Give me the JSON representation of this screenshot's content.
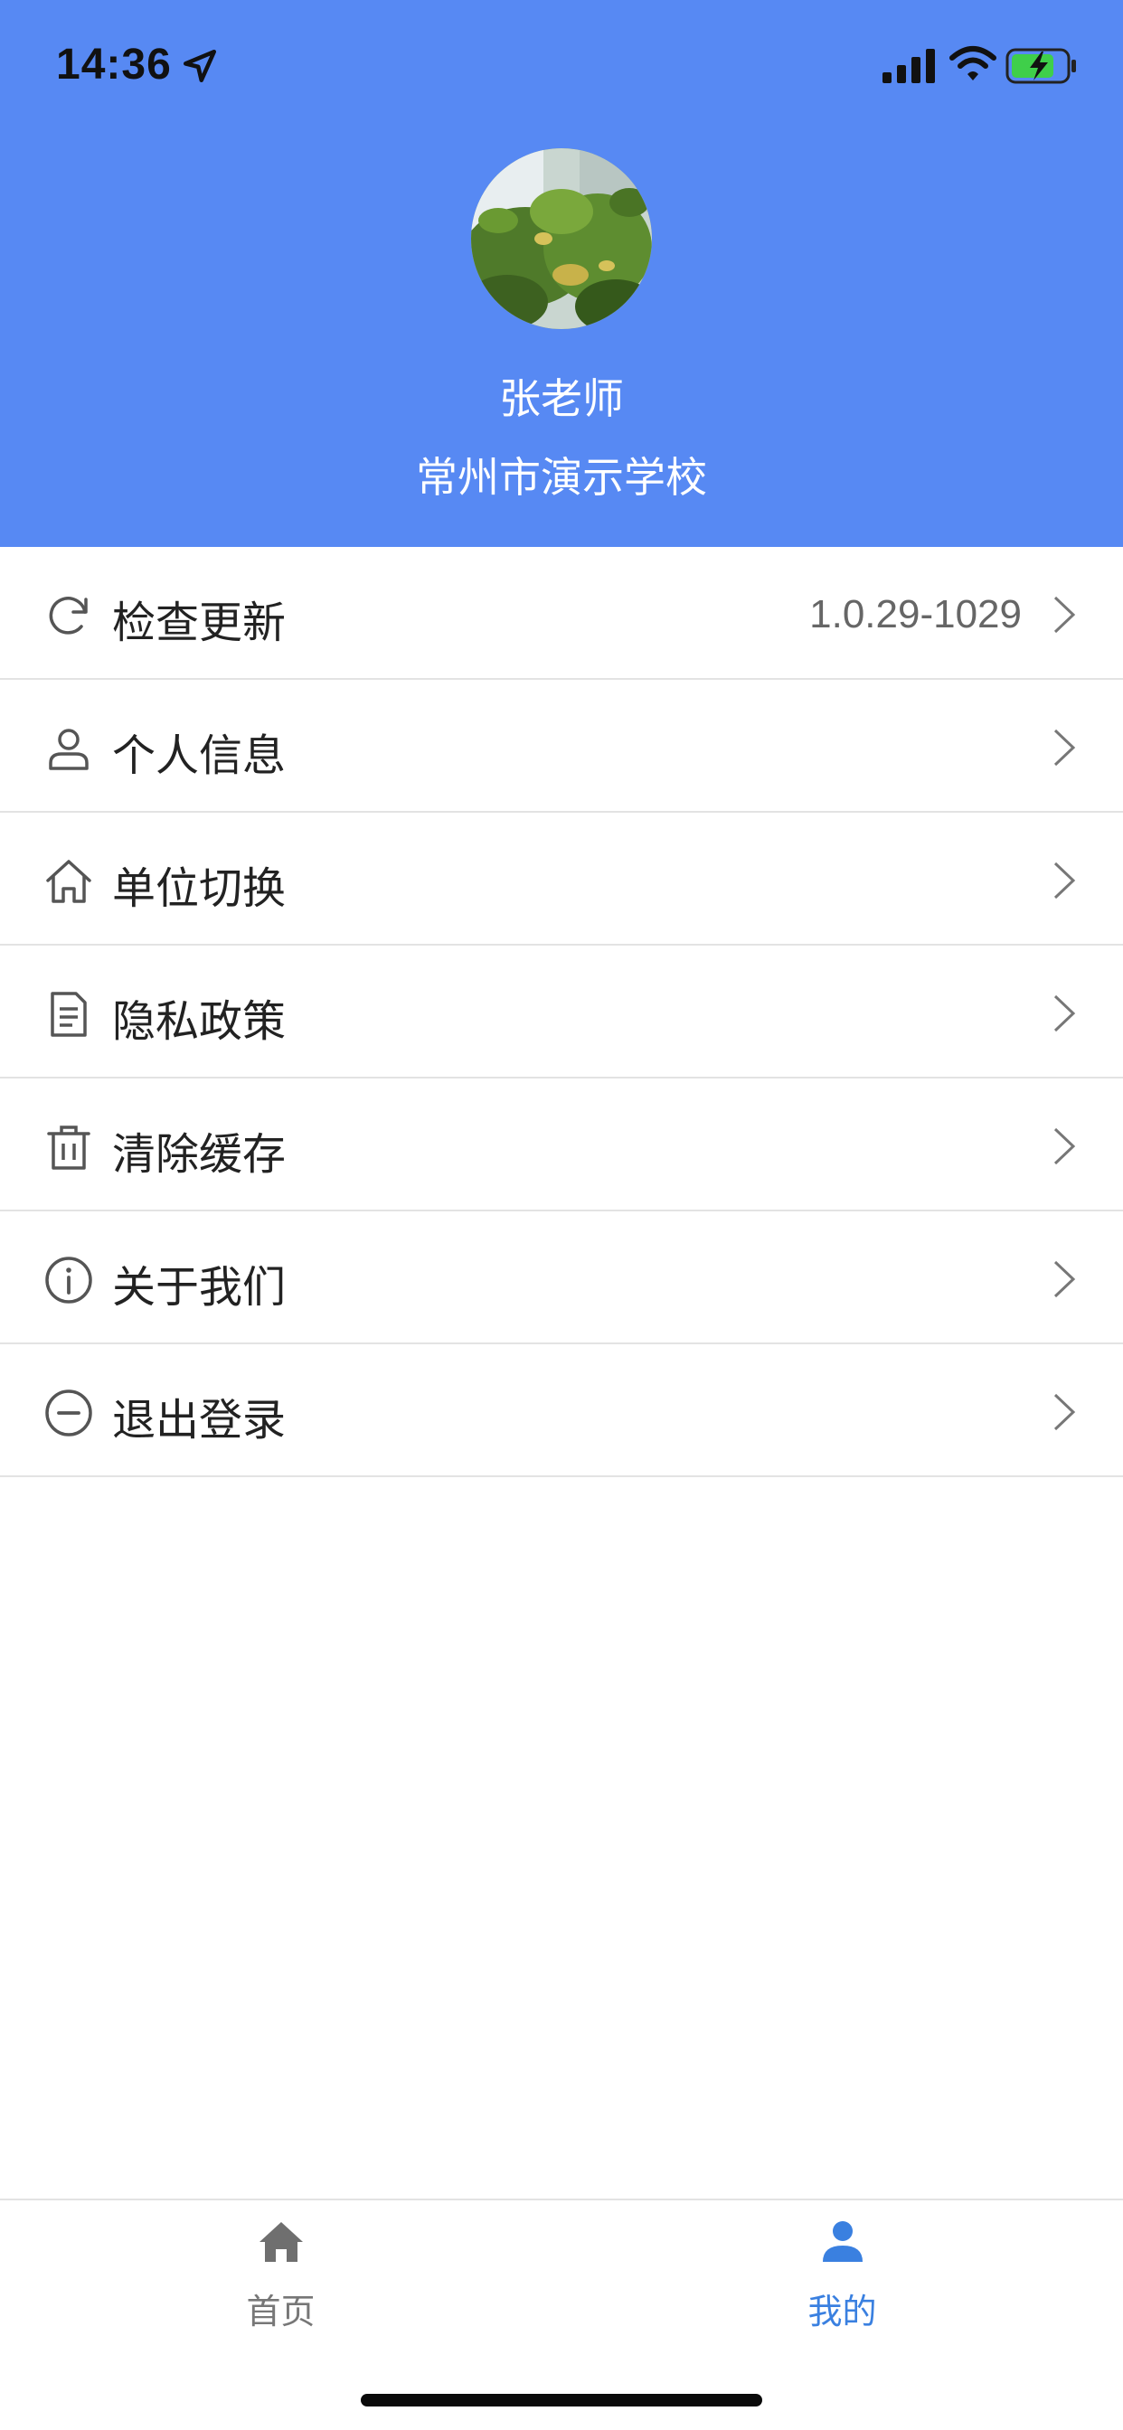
{
  "status_bar": {
    "time": "14:36"
  },
  "profile": {
    "name": "张老师",
    "school": "常州市演示学校"
  },
  "menu": {
    "items": [
      {
        "label": "检查更新",
        "value": "1.0.29-1029",
        "icon": "refresh-icon"
      },
      {
        "label": "个人信息",
        "value": "",
        "icon": "user-icon"
      },
      {
        "label": "单位切换",
        "value": "",
        "icon": "home-outline-icon"
      },
      {
        "label": "隐私政策",
        "value": "",
        "icon": "document-icon"
      },
      {
        "label": "清除缓存",
        "value": "",
        "icon": "trash-icon"
      },
      {
        "label": "关于我们",
        "value": "",
        "icon": "info-icon"
      },
      {
        "label": "退出登录",
        "value": "",
        "icon": "minus-circle-icon"
      }
    ]
  },
  "tabbar": {
    "tabs": [
      {
        "label": "首页",
        "icon": "home-icon",
        "active": false
      },
      {
        "label": "我的",
        "icon": "person-icon",
        "active": true
      }
    ]
  },
  "colors": {
    "header_bg": "#5789f3",
    "active_tab": "#3a80e0",
    "inactive_tab": "#777777"
  }
}
